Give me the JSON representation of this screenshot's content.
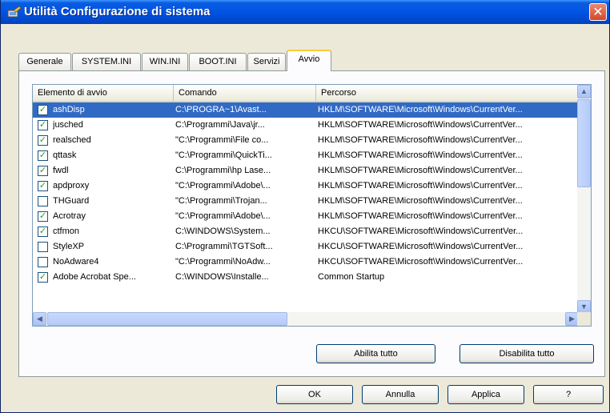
{
  "window": {
    "title": "Utilità Configurazione di sistema",
    "close_glyph": "✕"
  },
  "tabs": [
    {
      "label": "Generale"
    },
    {
      "label": "SYSTEM.INI"
    },
    {
      "label": "WIN.INI"
    },
    {
      "label": "BOOT.INI"
    },
    {
      "label": "Servizi"
    },
    {
      "label": "Avvio"
    }
  ],
  "active_tab": "Avvio",
  "listview": {
    "columns": [
      "Elemento di avvio",
      "Comando",
      "Percorso"
    ],
    "rows": [
      {
        "checked": true,
        "name": "ashDisp",
        "command": "C:\\PROGRA~1\\Avast...",
        "path": "HKLM\\SOFTWARE\\Microsoft\\Windows\\CurrentVer..."
      },
      {
        "checked": true,
        "name": "jusched",
        "command": "C:\\Programmi\\Java\\jr...",
        "path": "HKLM\\SOFTWARE\\Microsoft\\Windows\\CurrentVer..."
      },
      {
        "checked": true,
        "name": "realsched",
        "command": "\"C:\\Programmi\\File co...",
        "path": "HKLM\\SOFTWARE\\Microsoft\\Windows\\CurrentVer..."
      },
      {
        "checked": true,
        "name": "qttask",
        "command": "\"C:\\Programmi\\QuickTi...",
        "path": "HKLM\\SOFTWARE\\Microsoft\\Windows\\CurrentVer..."
      },
      {
        "checked": true,
        "name": "fwdl",
        "command": "C:\\Programmi\\hp Lase...",
        "path": "HKLM\\SOFTWARE\\Microsoft\\Windows\\CurrentVer..."
      },
      {
        "checked": true,
        "name": "apdproxy",
        "command": "\"C:\\Programmi\\Adobe\\...",
        "path": "HKLM\\SOFTWARE\\Microsoft\\Windows\\CurrentVer..."
      },
      {
        "checked": false,
        "name": "THGuard",
        "command": "\"C:\\Programmi\\Trojan...",
        "path": "HKLM\\SOFTWARE\\Microsoft\\Windows\\CurrentVer..."
      },
      {
        "checked": true,
        "name": "Acrotray",
        "command": "\"C:\\Programmi\\Adobe\\...",
        "path": "HKLM\\SOFTWARE\\Microsoft\\Windows\\CurrentVer..."
      },
      {
        "checked": true,
        "name": "ctfmon",
        "command": "C:\\WINDOWS\\System...",
        "path": "HKCU\\SOFTWARE\\Microsoft\\Windows\\CurrentVer..."
      },
      {
        "checked": false,
        "name": "StyleXP",
        "command": "C:\\Programmi\\TGTSoft...",
        "path": "HKCU\\SOFTWARE\\Microsoft\\Windows\\CurrentVer..."
      },
      {
        "checked": false,
        "name": "NoAdware4",
        "command": "\"C:\\Programmi\\NoAdw...",
        "path": "HKCU\\SOFTWARE\\Microsoft\\Windows\\CurrentVer..."
      },
      {
        "checked": true,
        "name": "Adobe Acrobat Spe...",
        "command": "C:\\WINDOWS\\Installe...",
        "path": "Common Startup"
      }
    ],
    "selected_row": 0
  },
  "buttons": {
    "enable_all": "Abilita tutto",
    "disable_all": "Disabilita tutto",
    "ok": "OK",
    "cancel": "Annulla",
    "apply": "Applica",
    "help": "?"
  },
  "scroll_glyphs": {
    "up": "▲",
    "down": "▼",
    "left": "◀",
    "right": "▶"
  },
  "colors": {
    "titlebar": "#0054e3",
    "selection": "#316ac5",
    "active_tab_accent": "#ffc73c"
  }
}
